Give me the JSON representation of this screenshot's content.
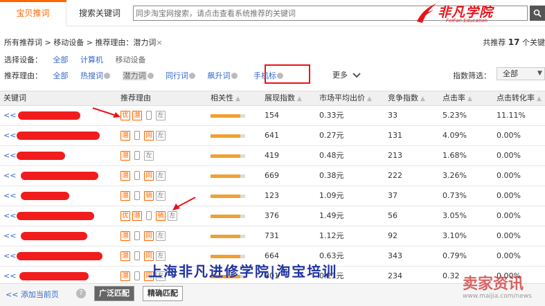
{
  "tabs": {
    "active": "宝贝推词",
    "inactive": "搜索关键词"
  },
  "search": {
    "placeholder": "同步淘宝网搜索，请点击查看系统推荐的关键词"
  },
  "logo": {
    "text": "非凡学院",
    "sub": "FeiFan Education"
  },
  "breadcrumb": {
    "root": "所有推荐词",
    "device": "移动设备",
    "reason": "推荐理由：潜力词",
    "close": "×"
  },
  "total": {
    "prefix": "共推荐",
    "count": "17",
    "suffix": "个关键"
  },
  "device_filter": {
    "label": "选择设备：",
    "options": [
      "全部",
      "计算机",
      "移动设备"
    ]
  },
  "reason_filter": {
    "label": "推荐理由：",
    "options": [
      "全部",
      "热搜词",
      "潜力词",
      "同行词",
      "飙升词",
      "手机标"
    ],
    "selected": "潜力词",
    "more": "更多"
  },
  "index_filter": {
    "label": "指数筛选：",
    "value": "全部"
  },
  "columns": [
    "关键词",
    "推荐理由",
    "相关性",
    "展现指数",
    "市场平均出价",
    "竞争指数",
    "点击率",
    "点击转化率"
  ],
  "rows": [
    {
      "tags": [
        "优",
        "潜",
        "phone",
        "左"
      ],
      "relevance": 0.85,
      "impressions": "154",
      "price": "0.33元",
      "competition": "33",
      "ctr": "5.23%",
      "cvr": "11.11%"
    },
    {
      "tags": [
        "潜",
        "phone",
        "同",
        "左"
      ],
      "relevance": 0.85,
      "impressions": "641",
      "price": "0.27元",
      "competition": "131",
      "ctr": "4.09%",
      "cvr": "0.00%"
    },
    {
      "tags": [
        "潜",
        "phone",
        "左"
      ],
      "relevance": 0.85,
      "impressions": "419",
      "price": "0.48元",
      "competition": "213",
      "ctr": "1.68%",
      "cvr": "0.00%"
    },
    {
      "tags": [
        "潜",
        "phone",
        "同",
        "左"
      ],
      "relevance": 0.85,
      "impressions": "669",
      "price": "0.38元",
      "competition": "222",
      "ctr": "3.26%",
      "cvr": "0.00%"
    },
    {
      "tags": [
        "潜",
        "phone",
        "销",
        "左"
      ],
      "relevance": 0.85,
      "impressions": "123",
      "price": "1.09元",
      "competition": "37",
      "ctr": "0.73%",
      "cvr": "0.00%"
    },
    {
      "tags": [
        "优",
        "潜",
        "phone",
        "销",
        "左"
      ],
      "relevance": 0.85,
      "impressions": "376",
      "price": "1.49元",
      "competition": "56",
      "ctr": "3.05%",
      "cvr": "0.00%"
    },
    {
      "tags": [
        "潜",
        "phone",
        "同",
        "左"
      ],
      "relevance": 0.85,
      "impressions": "731",
      "price": "1.12元",
      "competition": "92",
      "ctr": "3.10%",
      "cvr": "0.00%"
    },
    {
      "tags": [
        "潜",
        "phone",
        "同",
        "左"
      ],
      "relevance": 0.85,
      "impressions": "664",
      "price": "0.63元",
      "competition": "343",
      "ctr": "0.79%",
      "cvr": "0.00%"
    },
    {
      "tags": [
        "潜",
        "phone",
        "同",
        "左"
      ],
      "relevance": 0.85,
      "impressions": "801",
      "price": "0.21元",
      "competition": "234",
      "ctr": "0.32",
      "cvr": "0.00%"
    }
  ],
  "row_prefix": "<<",
  "footer": {
    "add": "<<  添加当前页",
    "help": "?",
    "broad": "广泛匹配",
    "exact": "精确匹配"
  },
  "watermark": {
    "line1": "上海非凡进修学院|淘宝培训",
    "site": "卖家资讯",
    "url": "www.maijia.com/news"
  },
  "colors": {
    "accent": "#ff6600",
    "link": "#3366cc",
    "annotation": "#e8141b"
  }
}
